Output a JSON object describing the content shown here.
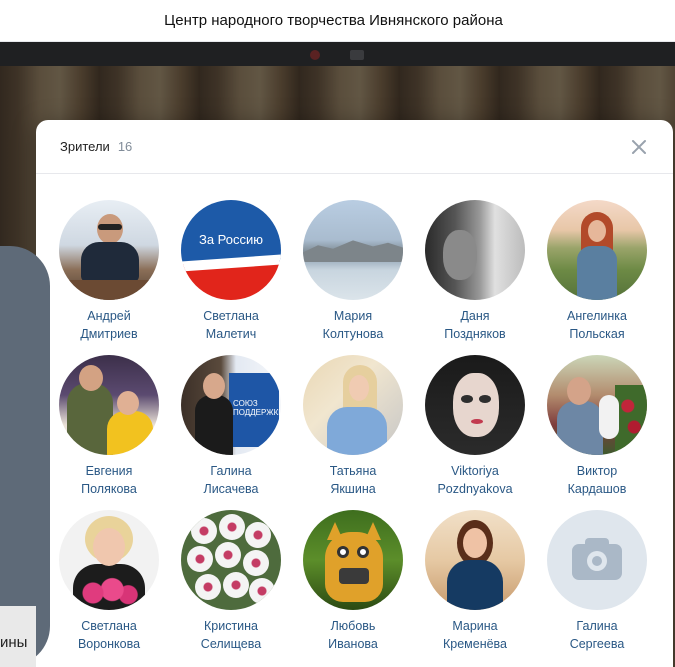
{
  "page": {
    "title": "Центр народного творчества Ивнянского района",
    "background_text": "ины"
  },
  "modal": {
    "title": "Зрители",
    "count": "16",
    "close_icon": "close-icon"
  },
  "viewers": [
    {
      "first": "Андрей",
      "last": "Дмитриев"
    },
    {
      "first": "Светлана",
      "last": "Малетич",
      "avatar_text": "За Россию"
    },
    {
      "first": "Мария",
      "last": "Колтунова"
    },
    {
      "first": "Даня",
      "last": "Поздняков"
    },
    {
      "first": "Ангелинка",
      "last": "Польская"
    },
    {
      "first": "Евгения",
      "last": "Полякова"
    },
    {
      "first": "Галина",
      "last": "Лисачева",
      "avatar_text": "СОЮЗ ПОДДЕРЖКИ"
    },
    {
      "first": "Татьяна",
      "last": "Якшина"
    },
    {
      "first": "Viktoriya",
      "last": "Pozdnyakova"
    },
    {
      "first": "Виктор",
      "last": "Кардашов"
    },
    {
      "first": "Светлана",
      "last": "Воронкова"
    },
    {
      "first": "Кристина",
      "last": "Селищева"
    },
    {
      "first": "Любовь",
      "last": "Иванова"
    },
    {
      "first": "Марина",
      "last": "Кременёва"
    },
    {
      "first": "Галина",
      "last": "Сергеева",
      "avatar": "camera-icon"
    }
  ],
  "colors": {
    "link": "#2a5885",
    "muted": "#818c99",
    "modal_bg": "#ffffff",
    "placeholder_avatar": "#dfe6ed"
  }
}
